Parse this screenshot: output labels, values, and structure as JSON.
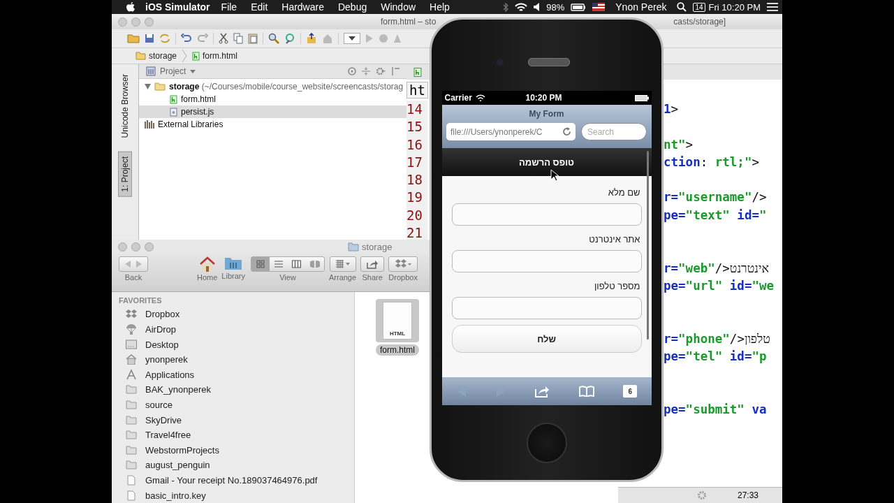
{
  "menubar": {
    "app": "iOS Simulator",
    "menus": [
      "File",
      "Edit",
      "Hardware",
      "Debug",
      "Window",
      "Help"
    ],
    "battery": "98%",
    "user": "Ynon Perek",
    "date_badge": "14",
    "clock": "Fri 10:20 PM"
  },
  "ide": {
    "title_left": "form.html – sto",
    "title_right": "casts/storage]",
    "breadcrumbs": [
      {
        "label": "storage",
        "kind": "folder"
      },
      {
        "label": "form.html",
        "kind": "html"
      }
    ],
    "side_tabs": [
      {
        "label": "Unicode Browser",
        "selected": false
      },
      {
        "label": "1: Project",
        "selected": true
      }
    ],
    "project_dropdown": "Project",
    "tree": [
      {
        "label": "storage",
        "path": "(~/Courses/mobile/course_website/screencasts/storag",
        "kind": "folder",
        "expanded": true,
        "selected": false,
        "children": [
          {
            "label": "form.html",
            "kind": "html",
            "selected": false
          },
          {
            "label": "persist.js",
            "kind": "js",
            "selected": true
          }
        ]
      },
      {
        "label": "External Libraries",
        "kind": "library",
        "selected": false
      }
    ],
    "editor_tab": "ht",
    "line_numbers": [
      "14",
      "15",
      "16",
      "17",
      "18",
      "19",
      "20",
      "21"
    ],
    "code_lines": [
      {
        "kind": "code",
        "segments": [
          {
            "kind": "tag",
            "text": "1"
          },
          {
            "kind": "plain",
            "text": ">"
          }
        ]
      },
      {
        "kind": "blank"
      },
      {
        "kind": "code",
        "segments": [
          {
            "kind": "string",
            "text": "nt\""
          },
          {
            "kind": "plain",
            "text": ">"
          }
        ]
      },
      {
        "kind": "code",
        "segments": [
          {
            "kind": "tag",
            "text": "ction"
          },
          {
            "kind": "plain",
            "text": ": "
          },
          {
            "kind": "string",
            "text": "rtl;\""
          },
          {
            "kind": "plain",
            "text": ">"
          }
        ]
      },
      {
        "kind": "blank"
      },
      {
        "kind": "code",
        "segments": [
          {
            "kind": "tag",
            "text": "r="
          },
          {
            "kind": "string",
            "text": "\"username\""
          },
          {
            "kind": "plain",
            "text": "/>"
          }
        ]
      },
      {
        "kind": "code",
        "segments": [
          {
            "kind": "tag",
            "text": "pe="
          },
          {
            "kind": "string",
            "text": "\"text\""
          },
          {
            "kind": "tag",
            "text": " id="
          },
          {
            "kind": "string",
            "text": "\""
          }
        ]
      },
      {
        "kind": "blank"
      },
      {
        "kind": "blank"
      },
      {
        "kind": "code",
        "segments": [
          {
            "kind": "tag",
            "text": "r="
          },
          {
            "kind": "string",
            "text": "\"web\""
          },
          {
            "kind": "plain",
            "text": "/>אינטרנט"
          }
        ]
      },
      {
        "kind": "code",
        "segments": [
          {
            "kind": "tag",
            "text": "pe="
          },
          {
            "kind": "string",
            "text": "\"url\""
          },
          {
            "kind": "tag",
            "text": " id="
          },
          {
            "kind": "string",
            "text": "\"we"
          }
        ]
      },
      {
        "kind": "blank"
      },
      {
        "kind": "blank"
      },
      {
        "kind": "code",
        "segments": [
          {
            "kind": "tag",
            "text": "r="
          },
          {
            "kind": "string",
            "text": "\"phone\""
          },
          {
            "kind": "plain",
            "text": "/>טלפון"
          }
        ]
      },
      {
        "kind": "code",
        "segments": [
          {
            "kind": "tag",
            "text": "pe="
          },
          {
            "kind": "string",
            "text": "\"tel\""
          },
          {
            "kind": "tag",
            "text": " id="
          },
          {
            "kind": "string",
            "text": "\"p"
          }
        ]
      },
      {
        "kind": "blank"
      },
      {
        "kind": "blank"
      },
      {
        "kind": "code",
        "segments": [
          {
            "kind": "tag",
            "text": "pe="
          },
          {
            "kind": "string",
            "text": "\"submit\""
          },
          {
            "kind": "tag",
            "text": " va"
          }
        ]
      }
    ],
    "status_time": "27:33"
  },
  "finder": {
    "title": "storage",
    "toolbar": [
      {
        "label": "Back",
        "kind": "nav"
      },
      {
        "label": "Home",
        "kind": "home"
      },
      {
        "label": "Library",
        "kind": "library"
      },
      {
        "label": "View",
        "kind": "view"
      },
      {
        "label": "Arrange",
        "kind": "arrange"
      },
      {
        "label": "Share",
        "kind": "share"
      },
      {
        "label": "Dropbox",
        "kind": "dropbox"
      }
    ],
    "view_modes": [
      {
        "kind": "icons",
        "selected": true
      },
      {
        "kind": "list",
        "selected": false
      },
      {
        "kind": "columns",
        "selected": false
      },
      {
        "kind": "coverflow",
        "selected": false
      }
    ],
    "favorites_header": "FAVORITES",
    "favorites": [
      {
        "label": "Dropbox",
        "kind": "dropbox"
      },
      {
        "label": "AirDrop",
        "kind": "airdrop"
      },
      {
        "label": "Desktop",
        "kind": "desktop"
      },
      {
        "label": "ynonperek",
        "kind": "home"
      },
      {
        "label": "Applications",
        "kind": "apps"
      },
      {
        "label": "BAK_ynonperek",
        "kind": "folder"
      },
      {
        "label": "source",
        "kind": "folder"
      },
      {
        "label": "SkyDrive",
        "kind": "folder"
      },
      {
        "label": "Travel4free",
        "kind": "folder"
      },
      {
        "label": "WebstormProjects",
        "kind": "folder"
      },
      {
        "label": "august_penguin",
        "kind": "folder"
      },
      {
        "label": "Gmail - Your receipt No.189037464976.pdf",
        "kind": "file"
      },
      {
        "label": "basic_intro.key",
        "kind": "file"
      }
    ],
    "file": {
      "name": "form.html",
      "badge": "HTML",
      "selected": true
    }
  },
  "simulator": {
    "carrier": "Carrier",
    "time": "10:20 PM",
    "page_title": "My Form",
    "url": "file:///Users/ynonperek/C",
    "search_placeholder": "Search",
    "header": "טופס הרשמה",
    "fields": [
      {
        "label": "שם מלא"
      },
      {
        "label": "אתר אינטרנט"
      },
      {
        "label": "מספר טלפון"
      }
    ],
    "submit": "שלח",
    "tabs_count": "6"
  }
}
